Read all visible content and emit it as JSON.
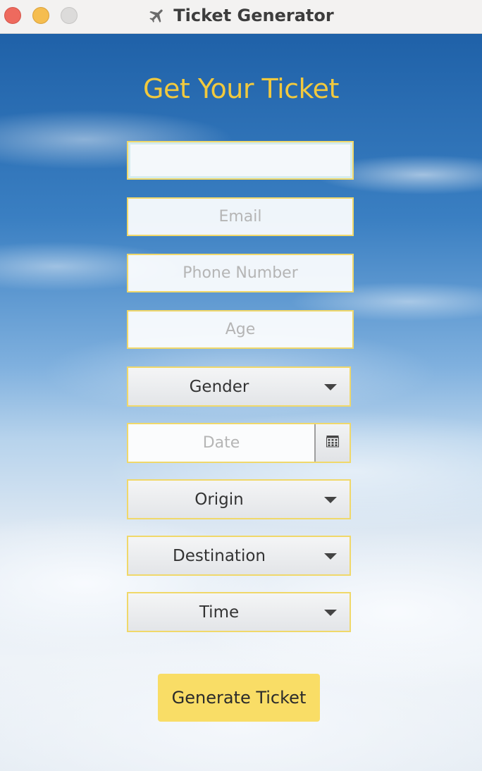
{
  "window": {
    "title": "Ticket Generator",
    "title_icon": "airplane-icon"
  },
  "form": {
    "heading": "Get Your Ticket",
    "name_value": "",
    "email_placeholder": "Email",
    "phone_placeholder": "Phone Number",
    "age_placeholder": "Age",
    "gender_label": "Gender",
    "date_placeholder": "Date",
    "date_icon": "calendar-icon",
    "origin_label": "Origin",
    "destination_label": "Destination",
    "time_label": "Time",
    "dropdown_icon": "chevron-down-icon",
    "submit_label": "Generate Ticket"
  },
  "colors": {
    "heading": "#f1c93e",
    "field_border": "#f0d86a",
    "button_bg": "#f9dd66",
    "close": "#ee6a5e",
    "minimize": "#f5bd4f",
    "zoom_disabled": "#dcdbda"
  }
}
